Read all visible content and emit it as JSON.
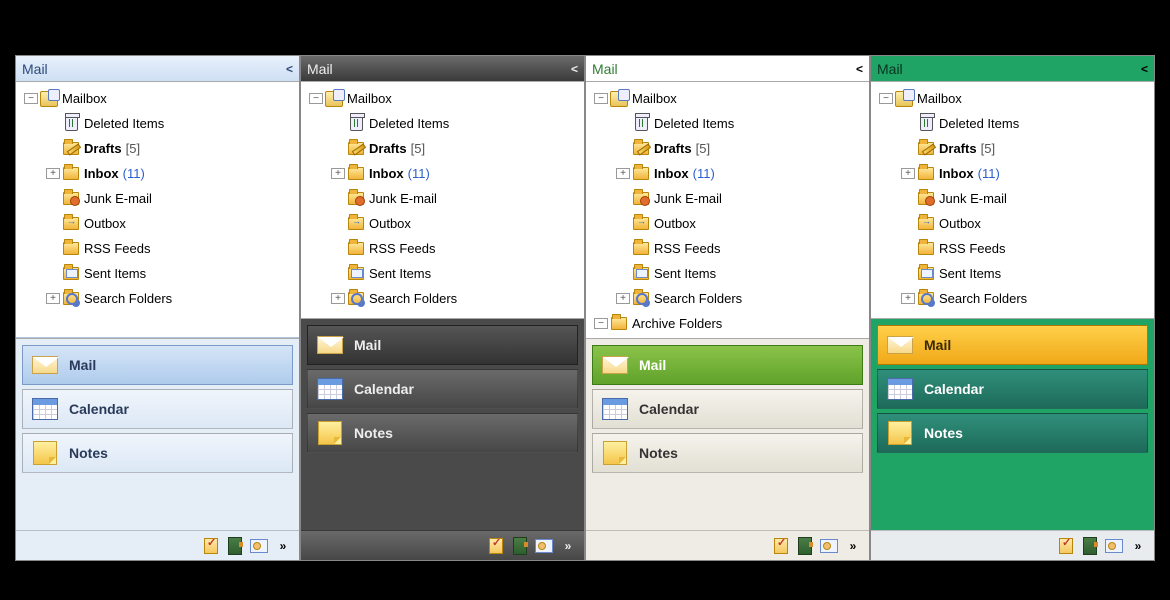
{
  "themes": [
    "blue",
    "dark",
    "green",
    "emerald"
  ],
  "header": {
    "title": "Mail"
  },
  "tree": {
    "root": "Mailbox",
    "items": [
      {
        "label": "Deleted Items",
        "icon": "trash"
      },
      {
        "label": "Drafts",
        "icon": "drafts",
        "bold": true,
        "count": 5,
        "count_style": "bracket"
      },
      {
        "label": "Inbox",
        "icon": "inbox",
        "bold": true,
        "count": 11,
        "count_style": "paren",
        "expandable": true
      },
      {
        "label": "Junk E-mail",
        "icon": "junk"
      },
      {
        "label": "Outbox",
        "icon": "outbox"
      },
      {
        "label": "RSS Feeds",
        "icon": "rss"
      },
      {
        "label": "Sent Items",
        "icon": "sent"
      },
      {
        "label": "Search Folders",
        "icon": "search",
        "expandable": true
      }
    ],
    "extra_green": "Archive Folders"
  },
  "nav": [
    {
      "key": "mail",
      "label": "Mail",
      "selected": true
    },
    {
      "key": "calendar",
      "label": "Calendar",
      "selected": false
    },
    {
      "key": "notes",
      "label": "Notes",
      "selected": false
    }
  ],
  "footer_icons": [
    "clipboard-check",
    "address-book",
    "contact-card",
    "more"
  ]
}
